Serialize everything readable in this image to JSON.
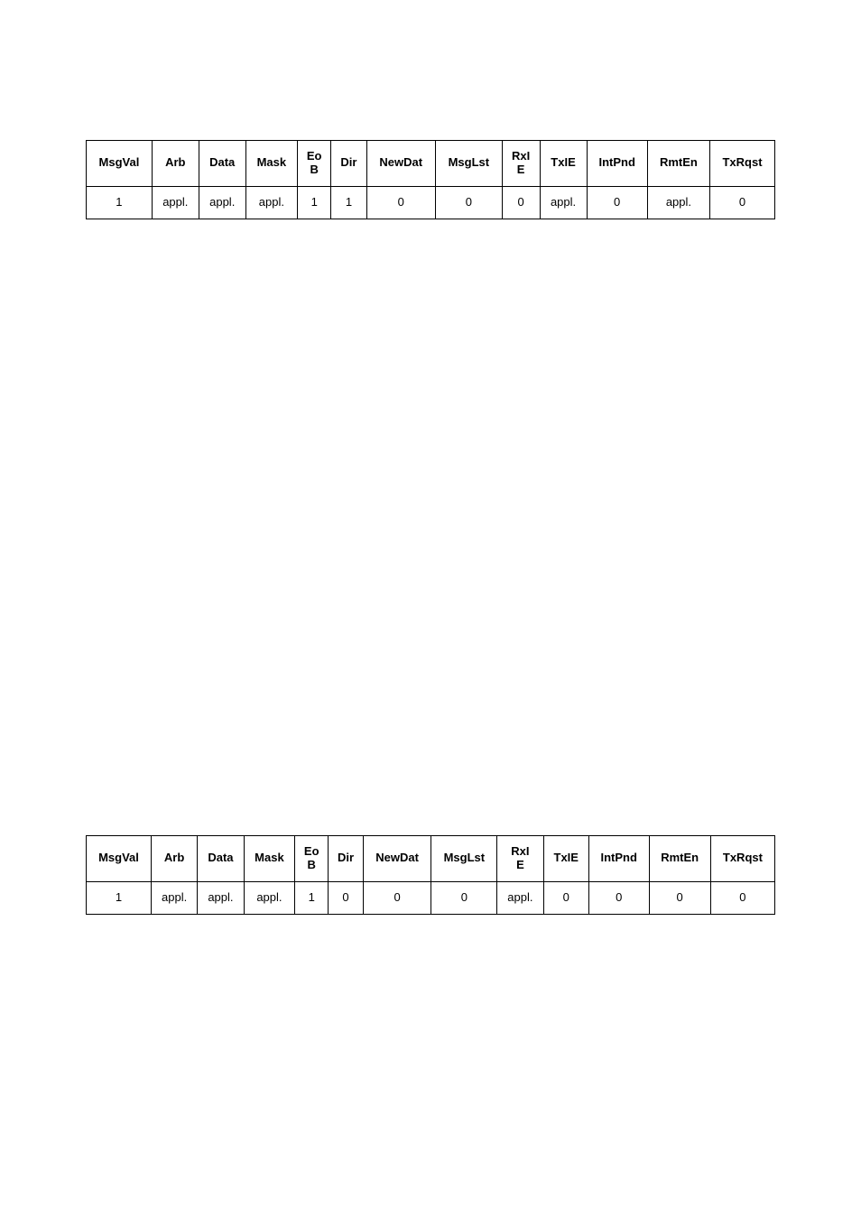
{
  "tables": [
    {
      "headers": [
        "MsgVal",
        "Arb",
        "Data",
        "Mask",
        "Eo\nB",
        "Dir",
        "NewDat",
        "MsgLst",
        "RxI\nE",
        "TxIE",
        "IntPnd",
        "RmtEn",
        "TxRqst"
      ],
      "row": [
        "1",
        "appl.",
        "appl.",
        "appl.",
        "1",
        "1",
        "0",
        "0",
        "0",
        "appl.",
        "0",
        "appl.",
        "0"
      ]
    },
    {
      "headers": [
        "MsgVal",
        "Arb",
        "Data",
        "Mask",
        "Eo\nB",
        "Dir",
        "NewDat",
        "MsgLst",
        "RxI\nE",
        "TxIE",
        "IntPnd",
        "RmtEn",
        "TxRqst"
      ],
      "row": [
        "1",
        "appl.",
        "appl.",
        "appl.",
        "1",
        "0",
        "0",
        "0",
        "appl.",
        "0",
        "0",
        "0",
        "0"
      ]
    }
  ]
}
